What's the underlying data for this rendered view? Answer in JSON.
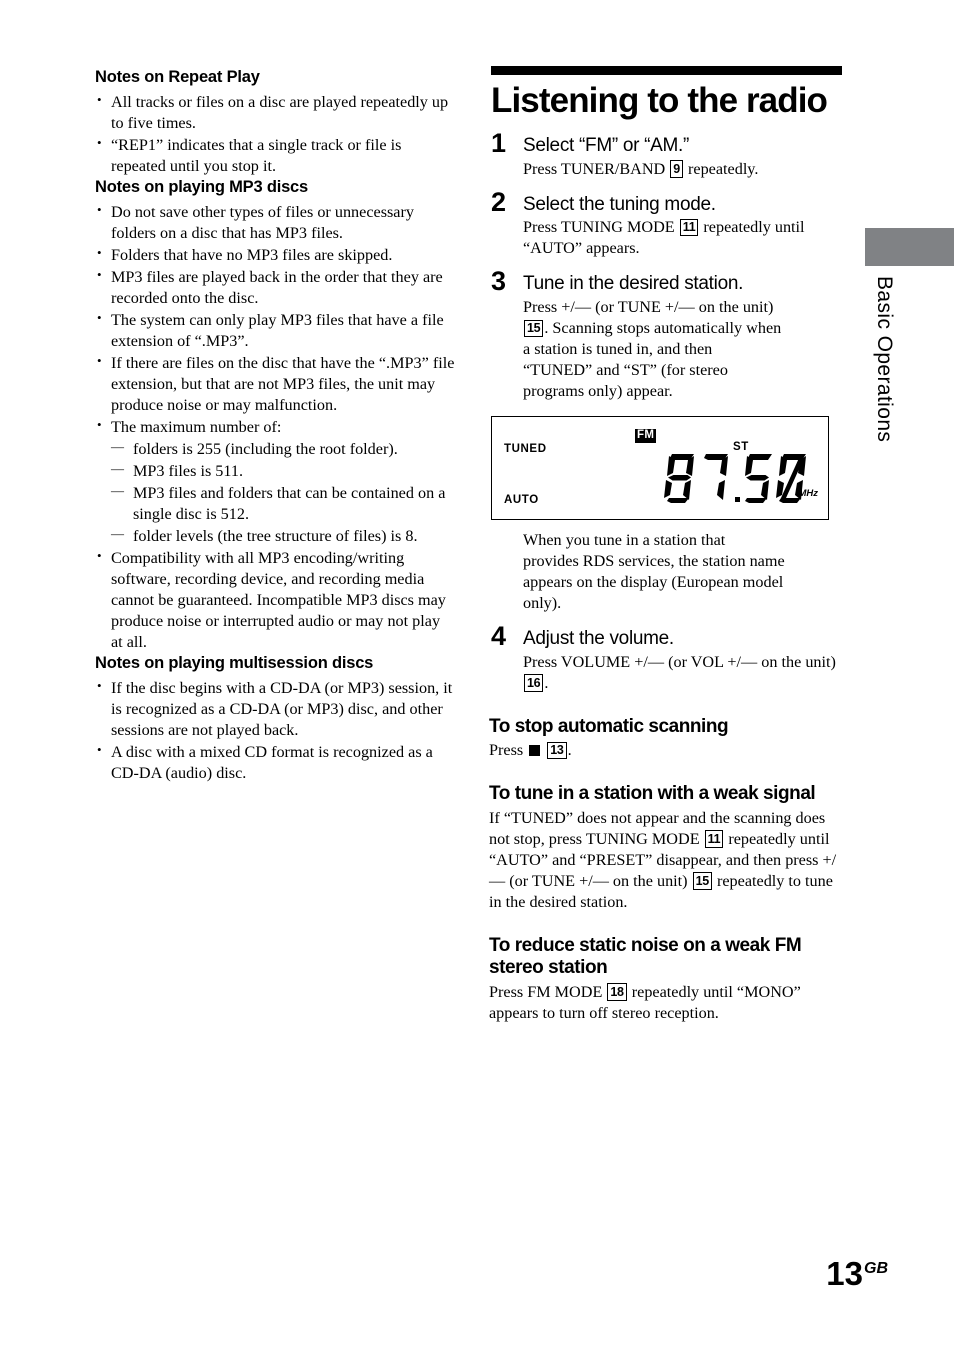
{
  "page": {
    "number": "13",
    "region_suffix": "GB",
    "side_tab_label": "Basic Operations",
    "side_tab_color": "#808285"
  },
  "left_column": {
    "sections": [
      {
        "heading": "Notes on Repeat Play",
        "bullets": [
          "All tracks or files on a disc are played repeatedly up to five times.",
          "“REP1” indicates that a single track or file is repeated until you stop it."
        ]
      },
      {
        "heading": "Notes on playing MP3 discs",
        "bullets": [
          "Do not save other types of files or unnecessary folders on a disc that has MP3 files.",
          "Folders that have no MP3 files are skipped.",
          "MP3 files are played back in the order that they are recorded onto the disc.",
          "The system can only play MP3 files that have a file extension of “.MP3”.",
          "If there are files on the disc that have the “.MP3” file extension, but that are not MP3 files, the unit may produce noise or may malfunction."
        ],
        "bullet_with_sublist": {
          "text": "The maximum number of:",
          "sub_items": [
            "folders is 255 (including the root folder).",
            "MP3 files is 511.",
            "MP3 files and folders that can be contained on a single disc is 512.",
            "folder levels (the tree structure of files) is 8."
          ]
        },
        "bullets_after": [
          "Compatibility with all MP3 encoding/writing software, recording device, and recording media cannot be guaranteed. Incompatible MP3 discs may produce noise or interrupted audio or may not play at all."
        ]
      },
      {
        "heading": "Notes on playing multisession discs",
        "bullets": [
          "If the disc begins with a CD-DA (or MP3) session, it is recognized as a CD-DA (or MP3) disc, and other sessions are not played back.",
          "A disc with a mixed CD format is recognized as a CD-DA (audio) disc."
        ]
      }
    ]
  },
  "right_column": {
    "chapter_title": "Listening to the radio",
    "steps": [
      {
        "number": "1",
        "title": "Select “FM” or “AM.”",
        "body_before": "Press TUNER/BAND",
        "ref": "9",
        "body_after": "repeatedly."
      },
      {
        "number": "2",
        "title": "Select the tuning mode.",
        "body_before": "Press TUNING MODE",
        "ref": "11",
        "body_after": "repeatedly until “AUTO” appears."
      },
      {
        "number": "3",
        "title": "Tune in the desired station.",
        "body_before": "Press +/— (or TUNE +/— on the unit)",
        "ref": "15",
        "body_after": ". Scanning stops automatically when a station is tuned in, and then “TUNED” and “ST” (for stereo programs only) appear."
      },
      {
        "number": "4",
        "title": "Adjust the volume.",
        "body_before": "Press VOLUME +/— (or VOL +/— on the unit)",
        "ref": "16",
        "body_after": "."
      }
    ],
    "display_illustration": {
      "indicator_tuned": "TUNED",
      "indicator_auto": "AUTO",
      "indicator_st": "ST",
      "band_badge": "FM",
      "frequency": "87.50",
      "frequency_digits": "8750",
      "unit": "MHz"
    },
    "rds_note": "When you tune in a station that provides RDS services, the station name appears on the display (European model only).",
    "subsections": [
      {
        "heading": "To stop automatic scanning",
        "body_before": "Press",
        "icon": "stop-square",
        "ref": "13",
        "body_after": "."
      },
      {
        "heading": "To tune in a station with a weak signal",
        "body_part1": "If “TUNED” does not appear and the scanning does not stop, press TUNING MODE",
        "ref1": "11",
        "body_part2": "repeatedly until “AUTO” and “PRESET” disappear, and then press +/— (or TUNE +/— on the unit)",
        "ref2": "15",
        "body_part3": "repeatedly to tune in the desired station."
      },
      {
        "heading": "To reduce static noise on a weak FM stereo station",
        "body_before": "Press FM MODE",
        "ref": "18",
        "body_after": "repeatedly until “MONO” appears to turn off stereo reception."
      }
    ]
  }
}
